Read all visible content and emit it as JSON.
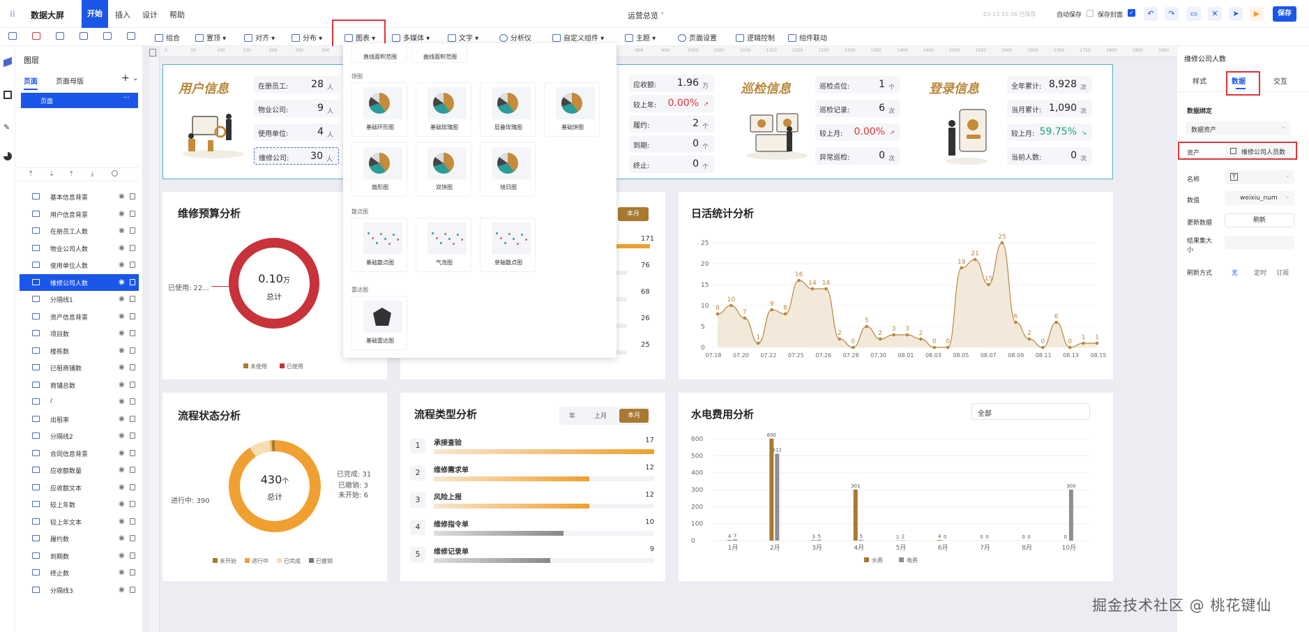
{
  "app": {
    "name": "数据大屏",
    "page_title": "运营总览",
    "save_info": "03-13 15:36 已保存",
    "auto_save": "自动保存",
    "save_cover": "保存封面",
    "save_btn": "保存"
  },
  "nav": [
    "开始",
    "插入",
    "设计",
    "帮助"
  ],
  "toolbar": [
    "组合",
    "置顶",
    "对齐",
    "分布",
    "图表",
    "多媒体",
    "文字",
    "分析仪",
    "自定义组件",
    "主题",
    "页面设置",
    "逻辑控制",
    "组件联动"
  ],
  "left": {
    "tabs": {
      "layers": "图层",
      "page": "页面",
      "master": "页面母版"
    },
    "page_item": "页面",
    "layers": [
      "基本信息背景",
      "用户信息背景",
      "在册员工人数",
      "物业公司人数",
      "使用单位人数",
      "维修公司人数",
      "分隔线1",
      "资产信息背景",
      "项目数",
      "楼栋数",
      "已租商铺数",
      "商铺总数",
      "/",
      "出租率",
      "分隔线2",
      "合同信息背景",
      "应收额数量",
      "应收额文本",
      "较上年数",
      "较上年文本",
      "履约数",
      "到期数",
      "终止数",
      "分隔线3"
    ]
  },
  "ruler": {
    "h": [
      "0",
      "50",
      "100",
      "150",
      "200",
      "250",
      "300",
      "350",
      "400",
      "450",
      "500",
      "550",
      "600",
      "650",
      "700",
      "750",
      "800",
      "850",
      "900",
      "950",
      "1000",
      "1050",
      "1100",
      "1150",
      "1200",
      "1250",
      "1300",
      "1350",
      "1400",
      "1450",
      "1500",
      "1550",
      "1600",
      "1650",
      "1700",
      "1750",
      "1800",
      "1850",
      "1900"
    ]
  },
  "user_info": {
    "title": "用户信息",
    "stats": [
      {
        "label": "在册员工:",
        "value": "28",
        "unit": "人"
      },
      {
        "label": "物业公司:",
        "value": "9",
        "unit": "人"
      },
      {
        "label": "使用单位:",
        "value": "4",
        "unit": "人"
      },
      {
        "label": "维修公司:",
        "value": "30",
        "unit": "人"
      }
    ]
  },
  "contract": {
    "stats": [
      {
        "label": "应收额:",
        "value": "1.96",
        "unit": "万"
      },
      {
        "label": "较上年:",
        "value": "0.00%",
        "unit": "↗"
      },
      {
        "label": "履约:",
        "value": "2",
        "unit": "个"
      },
      {
        "label": "到期:",
        "value": "0",
        "unit": "个"
      },
      {
        "label": "终止:",
        "value": "0",
        "unit": "个"
      }
    ]
  },
  "patrol": {
    "title": "巡检信息",
    "stats": [
      {
        "label": "巡检点位:",
        "value": "1",
        "unit": "个"
      },
      {
        "label": "巡检记录:",
        "value": "6",
        "unit": "次"
      },
      {
        "label": "较上月:",
        "value": "0.00%",
        "unit": "↗"
      },
      {
        "label": "异常巡检:",
        "value": "0",
        "unit": "次"
      }
    ]
  },
  "login": {
    "title": "登录信息",
    "stats": [
      {
        "label": "全年累计:",
        "value": "8,928",
        "unit": "次"
      },
      {
        "label": "当月累计:",
        "value": "1,090",
        "unit": "次"
      },
      {
        "label": "较上月:",
        "value": "59.75%",
        "unit": "↘"
      },
      {
        "label": "当前人数:",
        "value": "0",
        "unit": "次"
      }
    ]
  },
  "budget": {
    "title": "维修预算分析",
    "center_value": "0.10",
    "center_unit": "万",
    "center_label": "总计",
    "used_label": "已使用: 22...",
    "legend": [
      "未使用",
      "已使用"
    ]
  },
  "mid_list": {
    "tab": "本月",
    "values": [
      "171",
      "76",
      "68",
      "26",
      "25"
    ]
  },
  "flow_status": {
    "title": "流程状态分析",
    "center_value": "430",
    "center_unit": "个",
    "center_label": "总计",
    "labels": {
      "in_progress": "进行中: 390",
      "done": "已完成: 31",
      "cancel": "已撤销: 3",
      "not_started": "未开始: 6"
    },
    "legend": [
      "未开始",
      "进行中",
      "已完成",
      "已撤销"
    ]
  },
  "flow_type": {
    "title": "流程类型分析",
    "tabs": [
      "年",
      "上月",
      "本月"
    ],
    "items": [
      {
        "rank": "1",
        "name": "承接查验",
        "value": "17",
        "frac": 1.0
      },
      {
        "rank": "2",
        "name": "维修需求单",
        "value": "12",
        "frac": 0.706
      },
      {
        "rank": "3",
        "name": "风险上报",
        "value": "12",
        "frac": 0.706
      },
      {
        "rank": "4",
        "name": "维修指令单",
        "value": "10",
        "frac": 0.588
      },
      {
        "rank": "5",
        "name": "维修记录单",
        "value": "9",
        "frac": 0.529
      }
    ]
  },
  "popup": {
    "top_items": [
      "直线面积范围",
      "曲线面积范围"
    ],
    "sections": [
      {
        "name": "饼图",
        "items": [
          "基础环形图",
          "基础玫瑰图",
          "层叠玫瑰图",
          "基础饼图",
          "扇形图",
          "双饼图",
          "旭日图"
        ]
      },
      {
        "name": "散点图",
        "items": [
          "基础散点图",
          "气泡图",
          "单轴散点图"
        ]
      },
      {
        "name": "雷达图",
        "items": [
          "基础雷达图"
        ]
      }
    ]
  },
  "right": {
    "header": "维修公司人数",
    "tabs": [
      "样式",
      "数据",
      "交互"
    ],
    "binding_title": "数据绑定",
    "source": "数据资产",
    "asset_label": "资产",
    "asset_value": "维修公司人员数",
    "name_label": "名称",
    "name_value": "T",
    "value_label": "数值",
    "value_value": "weixiu_num",
    "update_label": "更新数据",
    "refresh": "刷新",
    "result_label": "结果集大小",
    "refresh_mode_label": "刷新方式",
    "refresh_modes": [
      "无",
      "定时",
      "订阅"
    ]
  },
  "watermark": "掘金技术社区 @ 桃花键仙",
  "chart_data": [
    {
      "type": "area",
      "title": "日活统计分析",
      "x": [
        "07.18",
        "07.19",
        "07.20",
        "07.21",
        "07.22",
        "07.23",
        "07.24",
        "07.25",
        "07.25b",
        "07.26",
        "07.27",
        "07.28",
        "07.29",
        "07.30",
        "07.31",
        "08.01",
        "08.02",
        "08.03",
        "08.04",
        "08.05",
        "08.06",
        "08.07",
        "08.08",
        "08.09",
        "08.10",
        "08.11",
        "08.12",
        "08.13",
        "08.14",
        "08.15"
      ],
      "x_tick_labels": [
        "07.18",
        "07.20",
        "07.22",
        "07.25",
        "07.26",
        "07.28",
        "07.30",
        "08.01",
        "08.03",
        "08.05",
        "08.07",
        "08.09",
        "08.11",
        "08.13",
        "08.15"
      ],
      "values": [
        8,
        10,
        7,
        1,
        9,
        8,
        16,
        14,
        14,
        2,
        0,
        5,
        2,
        3,
        3,
        2,
        0,
        0,
        19,
        21,
        15,
        25,
        6,
        2,
        0,
        6,
        0,
        1,
        1
      ],
      "yticks": [
        0,
        5,
        10,
        15,
        20,
        25
      ],
      "ylim": [
        0,
        25
      ],
      "grid": true
    },
    {
      "type": "bar",
      "title": "水电费用分析",
      "filter": "全部",
      "categories": [
        "1月",
        "2月",
        "3月",
        "4月",
        "5月",
        "6月",
        "7月",
        "8月",
        "10月"
      ],
      "series": [
        {
          "name": "水费",
          "values": [
            4,
            600,
            3,
            301,
            1,
            4,
            0,
            0,
            0
          ]
        },
        {
          "name": "电费",
          "values": [
            7,
            512,
            5,
            5,
            2,
            0,
            0,
            0,
            300
          ]
        }
      ],
      "yticks": [
        0,
        100,
        200,
        300,
        400,
        500,
        600
      ],
      "ylim": [
        0,
        650
      ]
    }
  ]
}
